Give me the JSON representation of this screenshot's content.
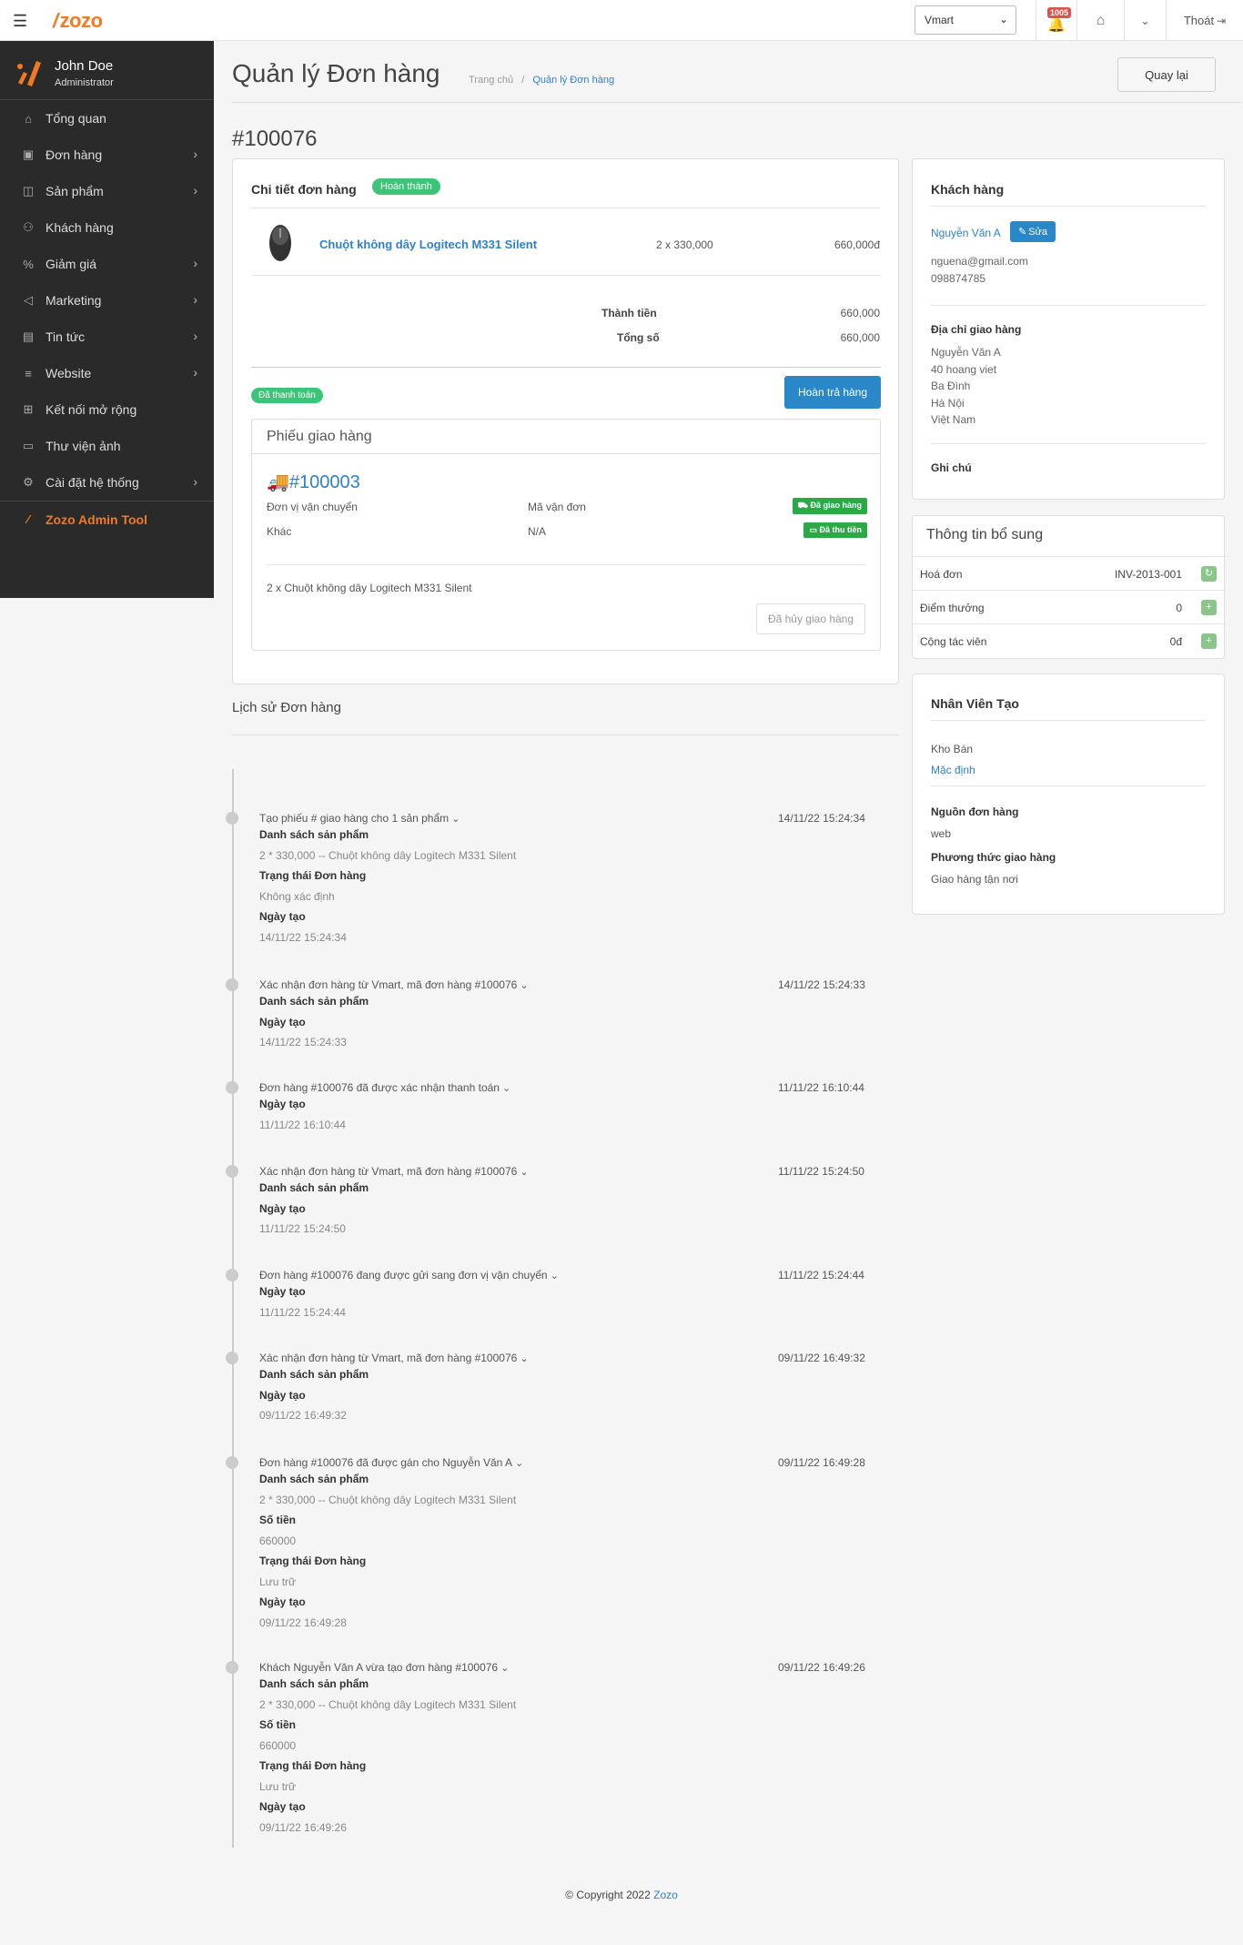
{
  "topbar": {
    "logo_text": "zozo",
    "store_select": "Vmart",
    "notification_count": "1005",
    "logout_label": "Thoát"
  },
  "sidebar": {
    "user_name": "John Doe",
    "user_role": "Administrator",
    "items": [
      {
        "label": "Tổng quan",
        "icon": "home-icon",
        "has_children": false
      },
      {
        "label": "Đơn hàng",
        "icon": "cart-icon",
        "has_children": true
      },
      {
        "label": "Sản phẩm",
        "icon": "bag-icon",
        "has_children": true
      },
      {
        "label": "Khách hàng",
        "icon": "users-icon",
        "has_children": false
      },
      {
        "label": "Giảm giá",
        "icon": "discount-icon",
        "has_children": true
      },
      {
        "label": "Marketing",
        "icon": "megaphone-icon",
        "has_children": true
      },
      {
        "label": "Tin tức",
        "icon": "news-icon",
        "has_children": true
      },
      {
        "label": "Website",
        "icon": "menu-icon",
        "has_children": true
      },
      {
        "label": "Kết nối mở rộng",
        "icon": "plugin-icon",
        "has_children": false
      },
      {
        "label": "Thư viện ảnh",
        "icon": "folder-icon",
        "has_children": false
      },
      {
        "label": "Cài đặt hệ thống",
        "icon": "settings-icon",
        "has_children": true
      }
    ],
    "admin_tool": "Zozo Admin Tool"
  },
  "header": {
    "title": "Quản lý Đơn hàng",
    "breadcrumb_home": "Trang chủ",
    "breadcrumb_sep": "/",
    "breadcrumb_current": "Quản lý Đơn hàng",
    "back_button": "Quay lại"
  },
  "order": {
    "number": "#100076",
    "details_title": "Chi tiết đơn hàng",
    "status": "Hoàn thành",
    "product_name": "Chuột không dây Logitech M331 Silent",
    "product_qty_price": "2 x 330,000",
    "product_total": "660,000đ",
    "subtotal_label": "Thành tiền",
    "subtotal_value": "660,000",
    "total_label": "Tổng số",
    "total_value": "660,000",
    "payment_status": "Đã thanh toán",
    "return_button": "Hoàn trả hàng"
  },
  "shipment": {
    "title": "Phiếu giao hàng",
    "number": "#100003",
    "carrier_label": "Đơn vị vận chuyển",
    "tracking_label": "Mã vận đơn",
    "carrier_value": "Khác",
    "tracking_value": "N/A",
    "tag_delivered": "Đã giao hàng",
    "tag_collected": "Đã thu tiền",
    "items_line": "2 x Chuột không dây Logitech M331 Silent",
    "cancel_button": "Đã hủy giao hàng"
  },
  "history": {
    "title": "Lịch sử Đơn hàng",
    "entries": [
      {
        "title": "Tạo phiếu # giao hàng cho 1 sản phẩm",
        "time": "14/11/22 15:24:34",
        "lines": [
          [
            "b",
            "Danh sách sản phẩm"
          ],
          [
            "v",
            "2 * 330,000 -- Chuột không dây Logitech M331 Silent"
          ],
          [
            "b",
            "Trạng thái Đơn hàng"
          ],
          [
            "v",
            "Không xác định"
          ],
          [
            "b",
            "Ngày tạo"
          ],
          [
            "v",
            "14/11/22 15:24:34"
          ]
        ]
      },
      {
        "title": "Xác nhận đơn hàng từ Vmart, mã đơn hàng #100076",
        "time": "14/11/22 15:24:33",
        "lines": [
          [
            "b",
            "Danh sách sản phẩm"
          ],
          [
            "b",
            "Ngày tạo"
          ],
          [
            "v",
            "14/11/22 15:24:33"
          ]
        ]
      },
      {
        "title": "Đơn hàng #100076 đã được xác nhận thanh toán",
        "time": "11/11/22 16:10:44",
        "lines": [
          [
            "b",
            "Ngày tạo"
          ],
          [
            "v",
            "11/11/22 16:10:44"
          ]
        ]
      },
      {
        "title": "Xác nhận đơn hàng từ Vmart, mã đơn hàng #100076",
        "time": "11/11/22 15:24:50",
        "lines": [
          [
            "b",
            "Danh sách sản phẩm"
          ],
          [
            "b",
            "Ngày tạo"
          ],
          [
            "v",
            "11/11/22 15:24:50"
          ]
        ]
      },
      {
        "title": "Đơn hàng #100076 đang được gửi sang đơn vị vận chuyển",
        "time": "11/11/22 15:24:44",
        "lines": [
          [
            "b",
            "Ngày tạo"
          ],
          [
            "v",
            "11/11/22 15:24:44"
          ]
        ]
      },
      {
        "title": "Xác nhận đơn hàng từ Vmart, mã đơn hàng #100076",
        "time": "09/11/22 16:49:32",
        "lines": [
          [
            "b",
            "Danh sách sản phẩm"
          ],
          [
            "b",
            "Ngày tạo"
          ],
          [
            "v",
            "09/11/22 16:49:32"
          ]
        ]
      },
      {
        "title": "Đơn hàng #100076 đã được gán cho Nguyễn Văn A",
        "time": "09/11/22 16:49:28",
        "lines": [
          [
            "b",
            "Danh sách sản phẩm"
          ],
          [
            "v",
            "2 * 330,000 -- Chuột không dây Logitech M331 Silent"
          ],
          [
            "b",
            "Số tiền"
          ],
          [
            "v",
            "660000"
          ],
          [
            "b",
            "Trạng thái Đơn hàng"
          ],
          [
            "v",
            "Lưu trữ"
          ],
          [
            "b",
            "Ngày tạo"
          ],
          [
            "v",
            "09/11/22 16:49:28"
          ]
        ]
      },
      {
        "title": "Khách Nguyễn Văn A vừa tạo đơn hàng #100076",
        "time": "09/11/22 16:49:26",
        "lines": [
          [
            "b",
            "Danh sách sản phẩm"
          ],
          [
            "v",
            "2 * 330,000 -- Chuột không dây Logitech M331 Silent"
          ],
          [
            "b",
            "Số tiền"
          ],
          [
            "v",
            "660000"
          ],
          [
            "b",
            "Trạng thái Đơn hàng"
          ],
          [
            "v",
            "Lưu trữ"
          ],
          [
            "b",
            "Ngày tạo"
          ],
          [
            "v",
            "09/11/22 16:49:26"
          ]
        ]
      }
    ]
  },
  "customer": {
    "title": "Khách hàng",
    "name": "Nguyễn Văn A",
    "edit_button": "Sửa",
    "email": "nguena@gmail.com",
    "phone": "098874785",
    "address_title": "Địa chỉ giao hàng",
    "address_lines": [
      "Nguyễn Văn A",
      "40 hoang viet",
      "Ba Đình",
      "Hà Nội",
      "Việt Nam"
    ],
    "note_title": "Ghi chú"
  },
  "extra": {
    "title": "Thông tin bổ sung",
    "rows": [
      {
        "label": "Hoá đơn",
        "value": "INV-2013-001",
        "icon": "refresh-icon"
      },
      {
        "label": "Điểm thưởng",
        "value": "0",
        "icon": "plus-icon"
      },
      {
        "label": "Cộng tác viên",
        "value": "0đ",
        "icon": "plus-icon"
      }
    ]
  },
  "staff": {
    "title": "Nhân Viên Tạo",
    "warehouse_label": "Kho Bán",
    "warehouse_value": "Mặc định",
    "source_title": "Nguồn đơn hàng",
    "source_value": "web",
    "shipping_method_title": "Phương thức giao hàng",
    "shipping_method_value": "Giao hàng tận nơi"
  },
  "footer": {
    "copyright": "© Copyright 2022",
    "brand": "Zozo"
  }
}
